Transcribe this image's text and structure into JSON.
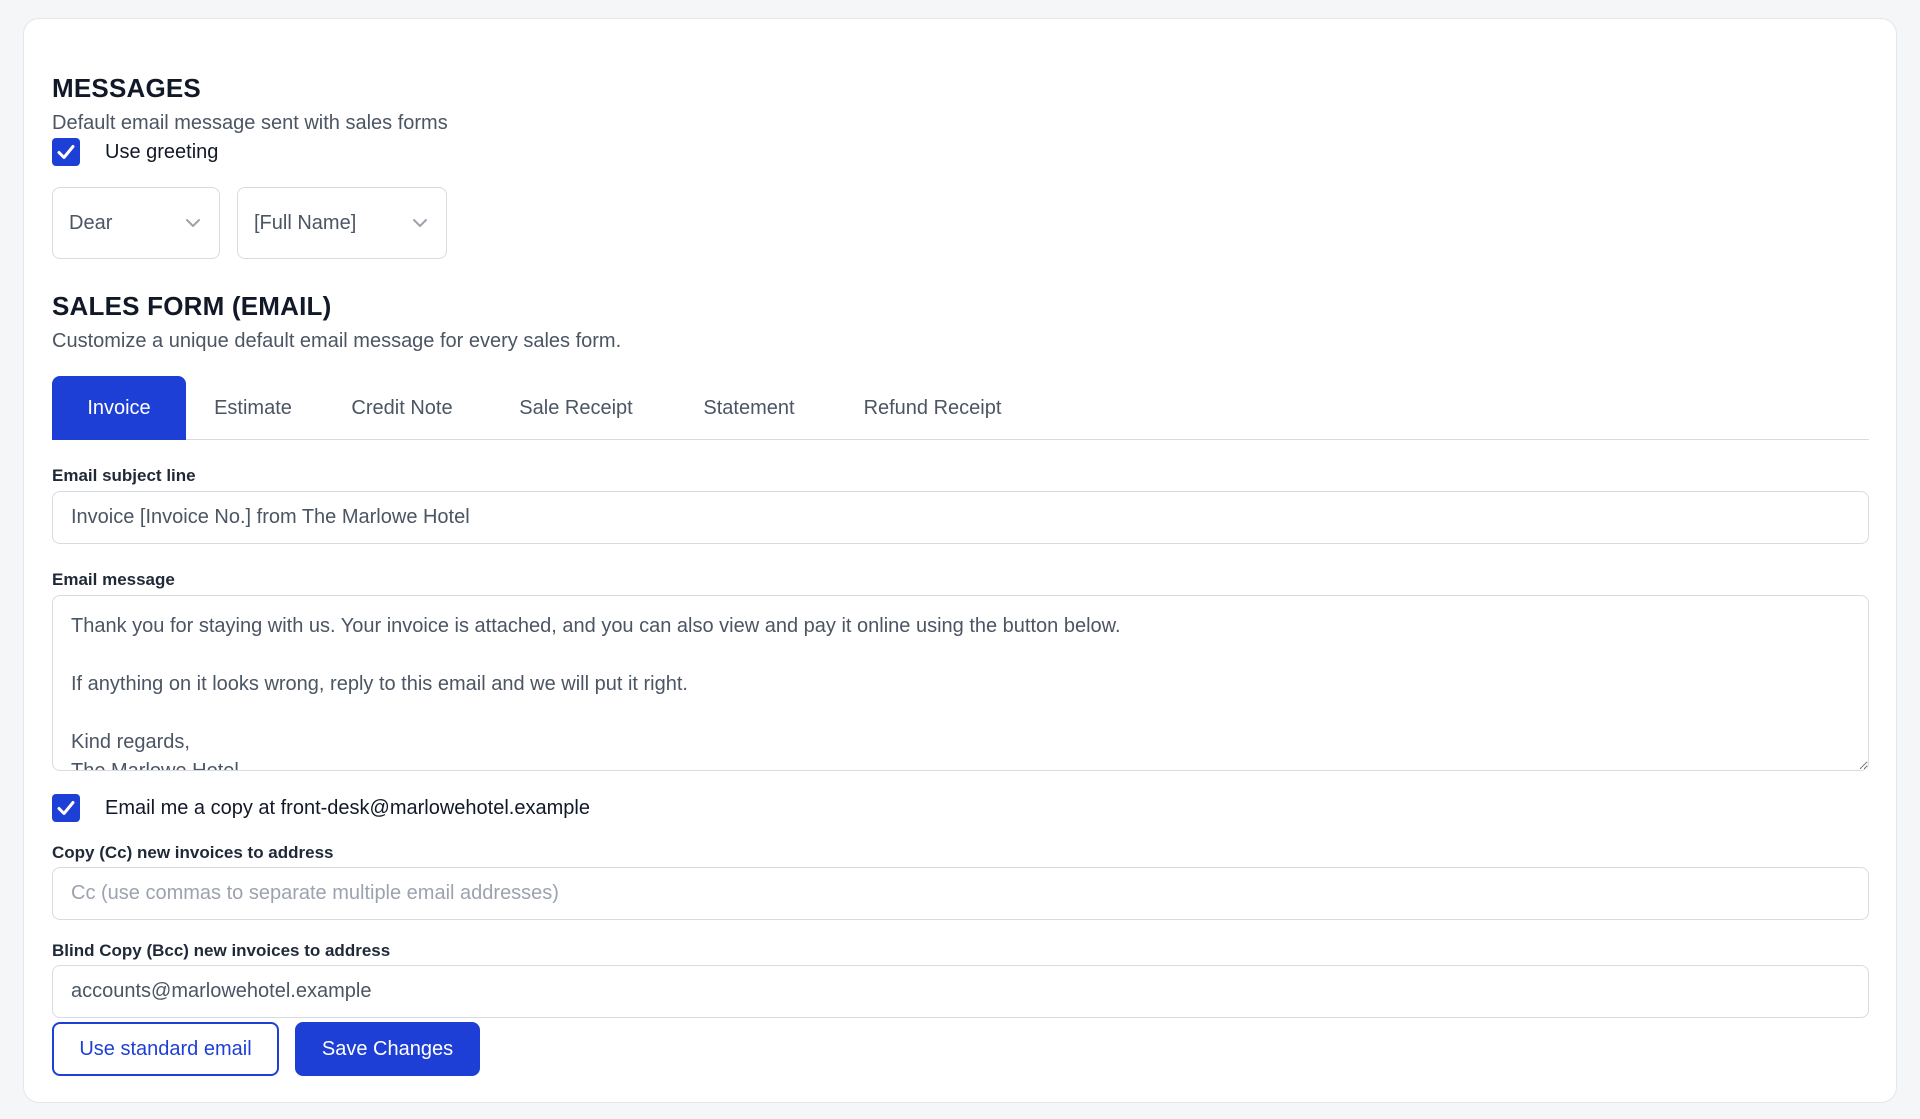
{
  "messages": {
    "title": "MESSAGES",
    "subtitle": "Default email message sent with sales forms",
    "use_greeting_label": "Use greeting",
    "use_greeting_checked": true,
    "greeting_select": "Dear",
    "name_select": "[Full Name]"
  },
  "sales_form": {
    "title": "SALES FORM (EMAIL)",
    "subtitle": "Customize a unique default email message for every sales form.",
    "tabs": [
      "Invoice",
      "Estimate",
      "Credit Note",
      "Sale Receipt",
      "Statement",
      "Refund Receipt"
    ],
    "active_tab": "Invoice"
  },
  "email": {
    "subject_label": "Email subject line",
    "subject_value": "Invoice [Invoice No.] from The Marlowe Hotel",
    "message_label": "Email message",
    "message_value": "Thank you for staying with us. Your invoice is attached, and you can also view and pay it online using the button below.\n\nIf anything on it looks wrong, reply to this email and we will put it right.\n\nKind regards,\nThe Marlowe Hotel",
    "copy_me_label": "Email me a copy at front-desk@marlowehotel.example",
    "copy_me_checked": true,
    "cc_label": "Copy (Cc) new invoices to address",
    "cc_placeholder": "Cc (use commas to separate multiple email addresses)",
    "bcc_label": "Blind Copy (Bcc) new invoices to address",
    "bcc_value": "accounts@marlowehotel.example"
  },
  "actions": {
    "standard_label": "Use standard email",
    "save_label": "Save Changes"
  },
  "colors": {
    "accent": "#1d3fd6",
    "border": "#d7dbe2",
    "background": "#f5f6f8"
  },
  "icons": {
    "checkbox": "checkmark-icon",
    "select": "chevron-down-icon"
  }
}
